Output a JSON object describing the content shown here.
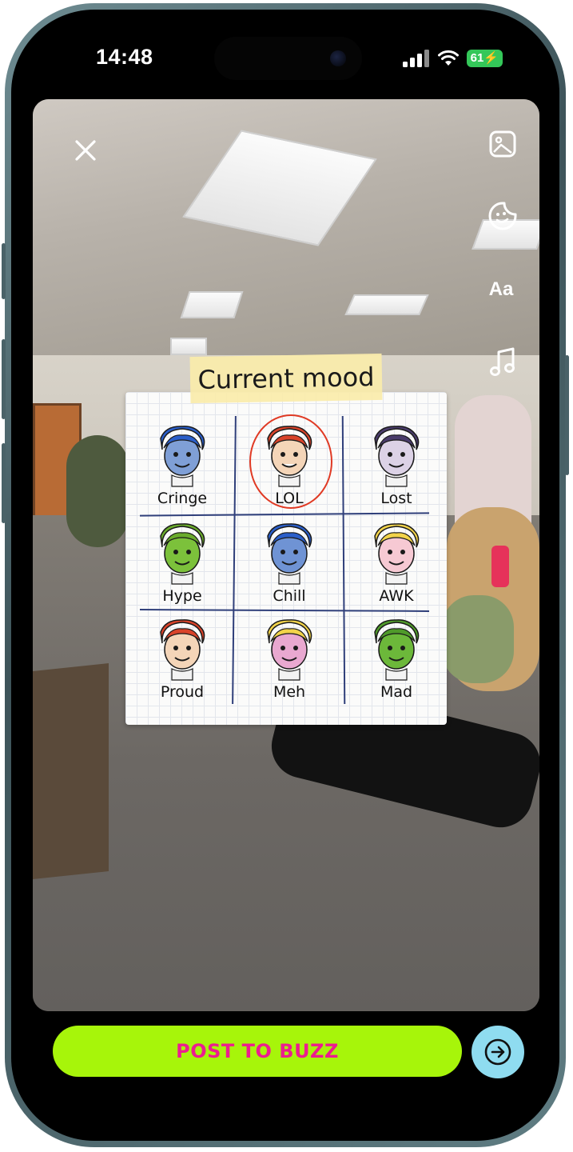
{
  "status_bar": {
    "time": "14:48",
    "battery": "61"
  },
  "toolbar": {
    "close_icon": "close-icon",
    "gallery_icon": "image-icon",
    "sticker_icon": "sticker-icon",
    "text_label": "Aa",
    "music_icon": "music-note-icon"
  },
  "sticker": {
    "title": "Current mood",
    "moods": [
      {
        "label": "Cringe",
        "hair": "#2a5ec9",
        "skin": "#7f9fd6"
      },
      {
        "label": "LOL",
        "hair": "#d9432a",
        "skin": "#f4d5b8",
        "selected": true
      },
      {
        "label": "Lost",
        "hair": "#4a3c6b",
        "skin": "#dcd2e6"
      },
      {
        "label": "Hype",
        "hair": "#6aab2c",
        "skin": "#7cc13b"
      },
      {
        "label": "Chill",
        "hair": "#2a5ec9",
        "skin": "#6f93d4"
      },
      {
        "label": "AWK",
        "hair": "#f2d34a",
        "skin": "#f6c9d3"
      },
      {
        "label": "Proud",
        "hair": "#d9432a",
        "skin": "#f4d5b8"
      },
      {
        "label": "Meh",
        "hair": "#f2d34a",
        "skin": "#e9a8d0"
      },
      {
        "label": "Mad",
        "hair": "#4f9a2a",
        "skin": "#6cb83a"
      }
    ],
    "highlight_color": "#e03a24"
  },
  "bottom": {
    "post_label": "POST TO BUZZ",
    "next_icon": "arrow-right-circle-icon"
  },
  "colors": {
    "post_bg": "#a7f50a",
    "post_text": "#ec1d8f",
    "next_bg": "#8fdcf0"
  }
}
